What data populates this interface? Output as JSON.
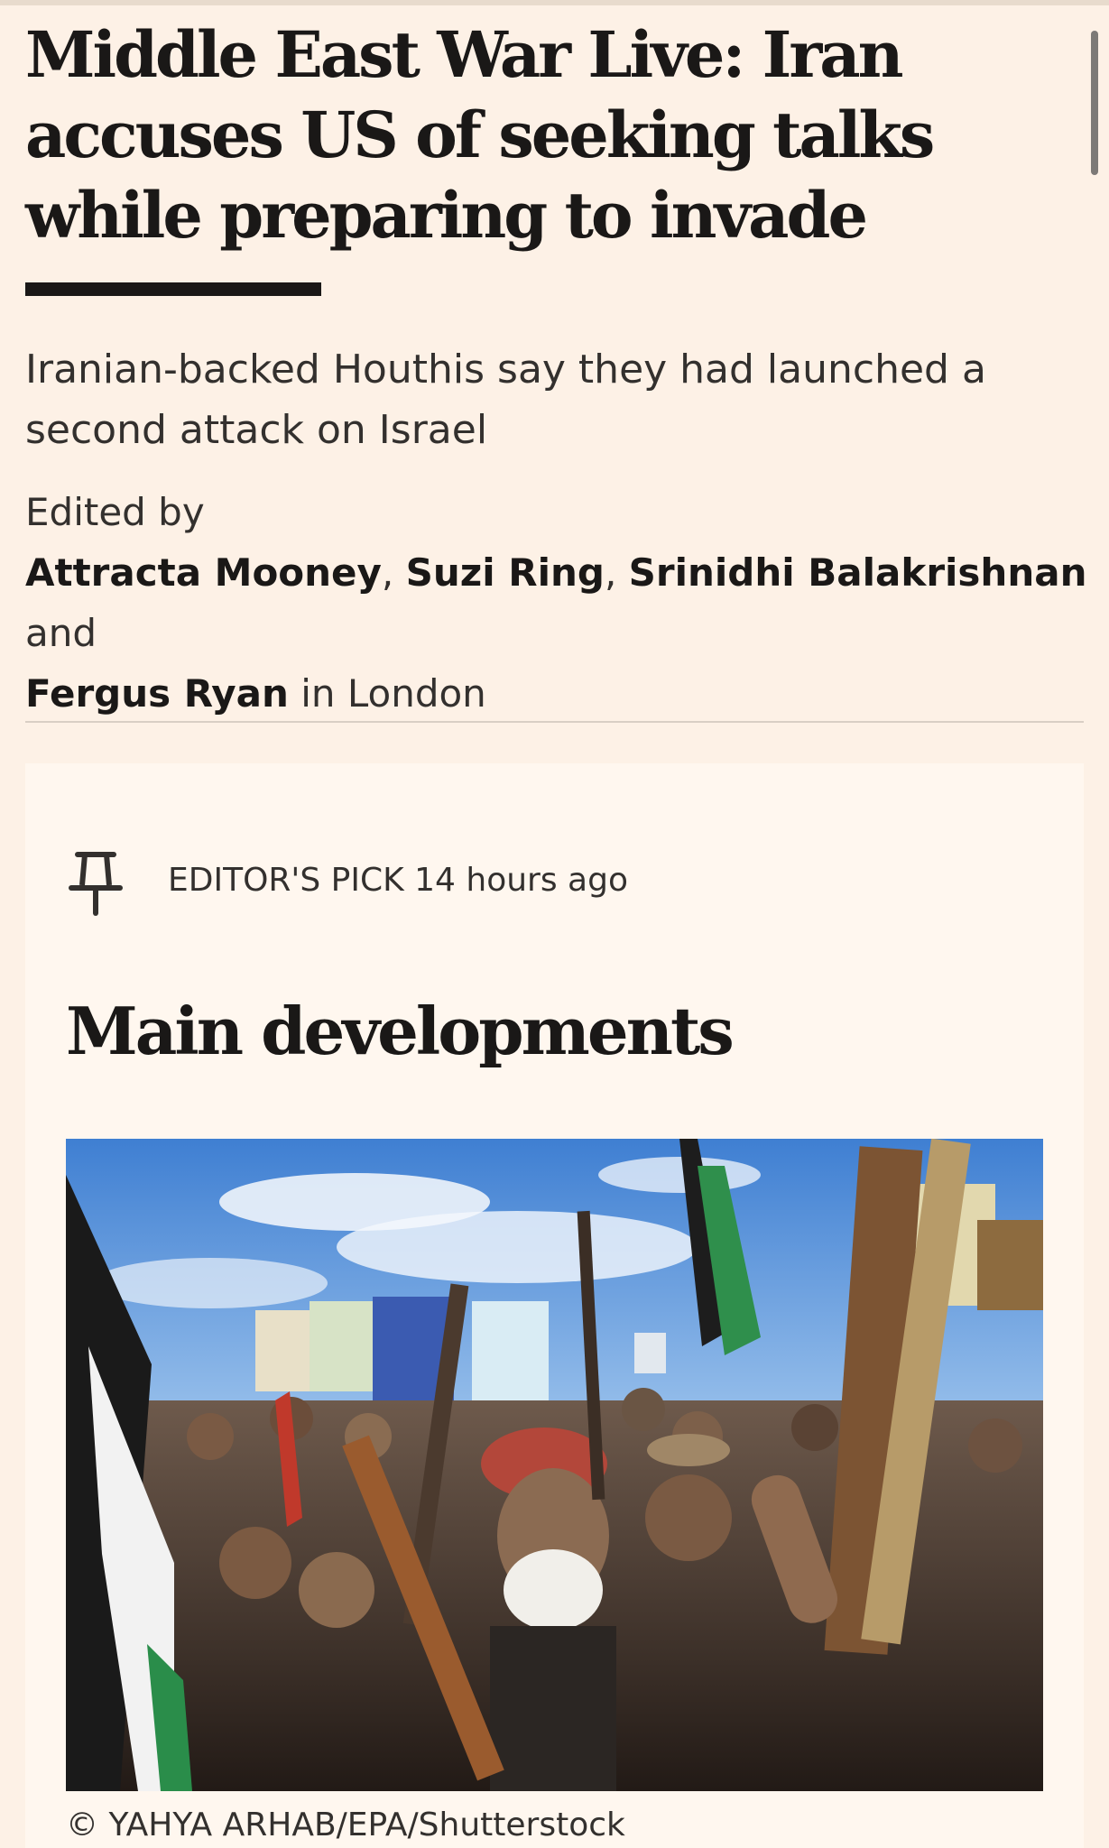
{
  "article": {
    "headline": "Middle East War Live: Iran accuses US of seeking talks while preparing to invade",
    "standfirst": "Iranian-backed Houthis say they had launched a second attack on Israel",
    "edited_by_label": "Edited by",
    "authors": [
      "Attracta Mooney",
      "Suzi Ring",
      "Srinidhi Balakrishnan",
      "Fergus Ryan"
    ],
    "author_sep": ", ",
    "and_text": " and ",
    "location_text": " in London"
  },
  "pinned_post": {
    "icon": "pin-icon",
    "label": "EDITOR'S PICK",
    "time": "14 hours ago",
    "title": "Main developments",
    "image_description": "Crowd of armed protesters holding rifles, flags and placards under a blue sky",
    "image_credit": "© YAHYA ARHAB/EPA/Shutterstock"
  },
  "colors": {
    "page_background": "#fdf1e6",
    "card_background": "#fff7ef",
    "headline_text": "#1a1817",
    "body_text": "#33302e",
    "divider": "#d9cfc5"
  }
}
